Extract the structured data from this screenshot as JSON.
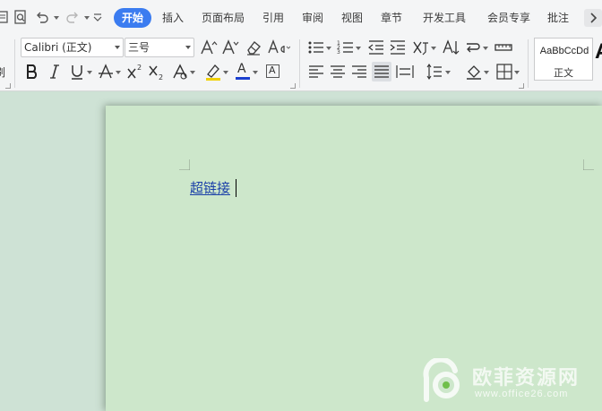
{
  "tabs": [
    {
      "label": "开始",
      "active": true
    },
    {
      "label": "插入"
    },
    {
      "label": "页面布局"
    },
    {
      "label": "引用"
    },
    {
      "label": "审阅"
    },
    {
      "label": "视图"
    },
    {
      "label": "章节"
    },
    {
      "label": "开发工具"
    },
    {
      "label": "会员专享"
    },
    {
      "label": "批注"
    }
  ],
  "font": {
    "family_value": "Calibri (正文)",
    "size_value": "三号"
  },
  "styles": {
    "sample_text": "AaBbCcDd",
    "current_style": "正文",
    "next_style_glyph": "A"
  },
  "ribbon_labels": {
    "font_color_glyph": "A",
    "char_border_glyph": "A"
  },
  "document": {
    "hyperlink_text": "超链接"
  },
  "watermark": {
    "title": "欧菲资源网",
    "url": "www.office26.com"
  },
  "colors": {
    "accent": "#3b7cf0",
    "page_bg": "#cde7cb",
    "font_color_bar": "#1a3fcf",
    "highlight_bar": "#f0d000",
    "hyperlink": "#1a3fa8"
  }
}
